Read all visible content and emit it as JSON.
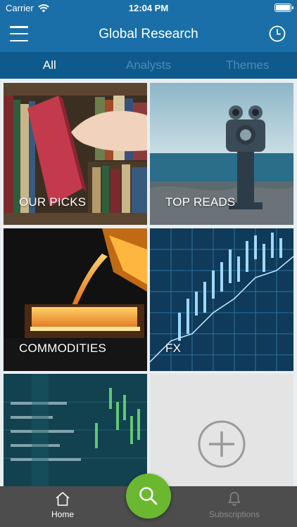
{
  "status_bar": {
    "carrier": "Carrier",
    "time": "12:04 PM"
  },
  "header": {
    "title": "Global Research",
    "menu_icon": "hamburger-menu-icon",
    "history_icon": "clock-icon"
  },
  "tabs": [
    {
      "label": "All",
      "active": true
    },
    {
      "label": "Analysts",
      "active": false
    },
    {
      "label": "Themes",
      "active": false
    }
  ],
  "tiles": [
    {
      "label": "OUR PICKS"
    },
    {
      "label": "TOP READS"
    },
    {
      "label": "COMMODITIES"
    },
    {
      "label": "FX"
    }
  ],
  "add_tile": {
    "icon": "add-circle-icon"
  },
  "tab_bar": {
    "home_label": "Home",
    "subscriptions_label": "Subscriptions",
    "search_icon": "search-icon"
  },
  "colors": {
    "header": "#1a6fa8",
    "tabs": "#0f5a8c",
    "fab": "#6ab830",
    "tab_bar": "#4d4d4d"
  }
}
